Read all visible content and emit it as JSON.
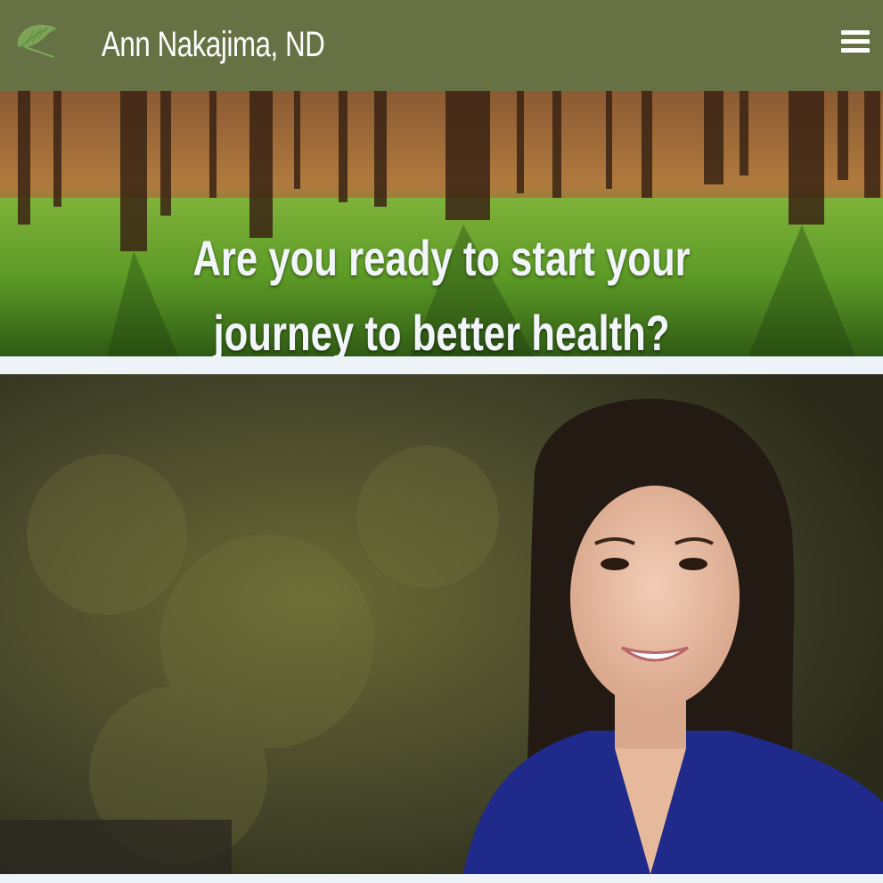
{
  "header": {
    "logo_icon": "ginkgo-leaf-icon",
    "title": "Ann Nakajima, ND",
    "menu_icon": "hamburger-menu-icon",
    "background_color": "#677244"
  },
  "hero": {
    "headline_line1": "Are you ready to start your",
    "headline_line2": "journey to better health?",
    "image_description_icon": "forest-image"
  },
  "portrait": {
    "image_icon": "portrait-photo"
  }
}
